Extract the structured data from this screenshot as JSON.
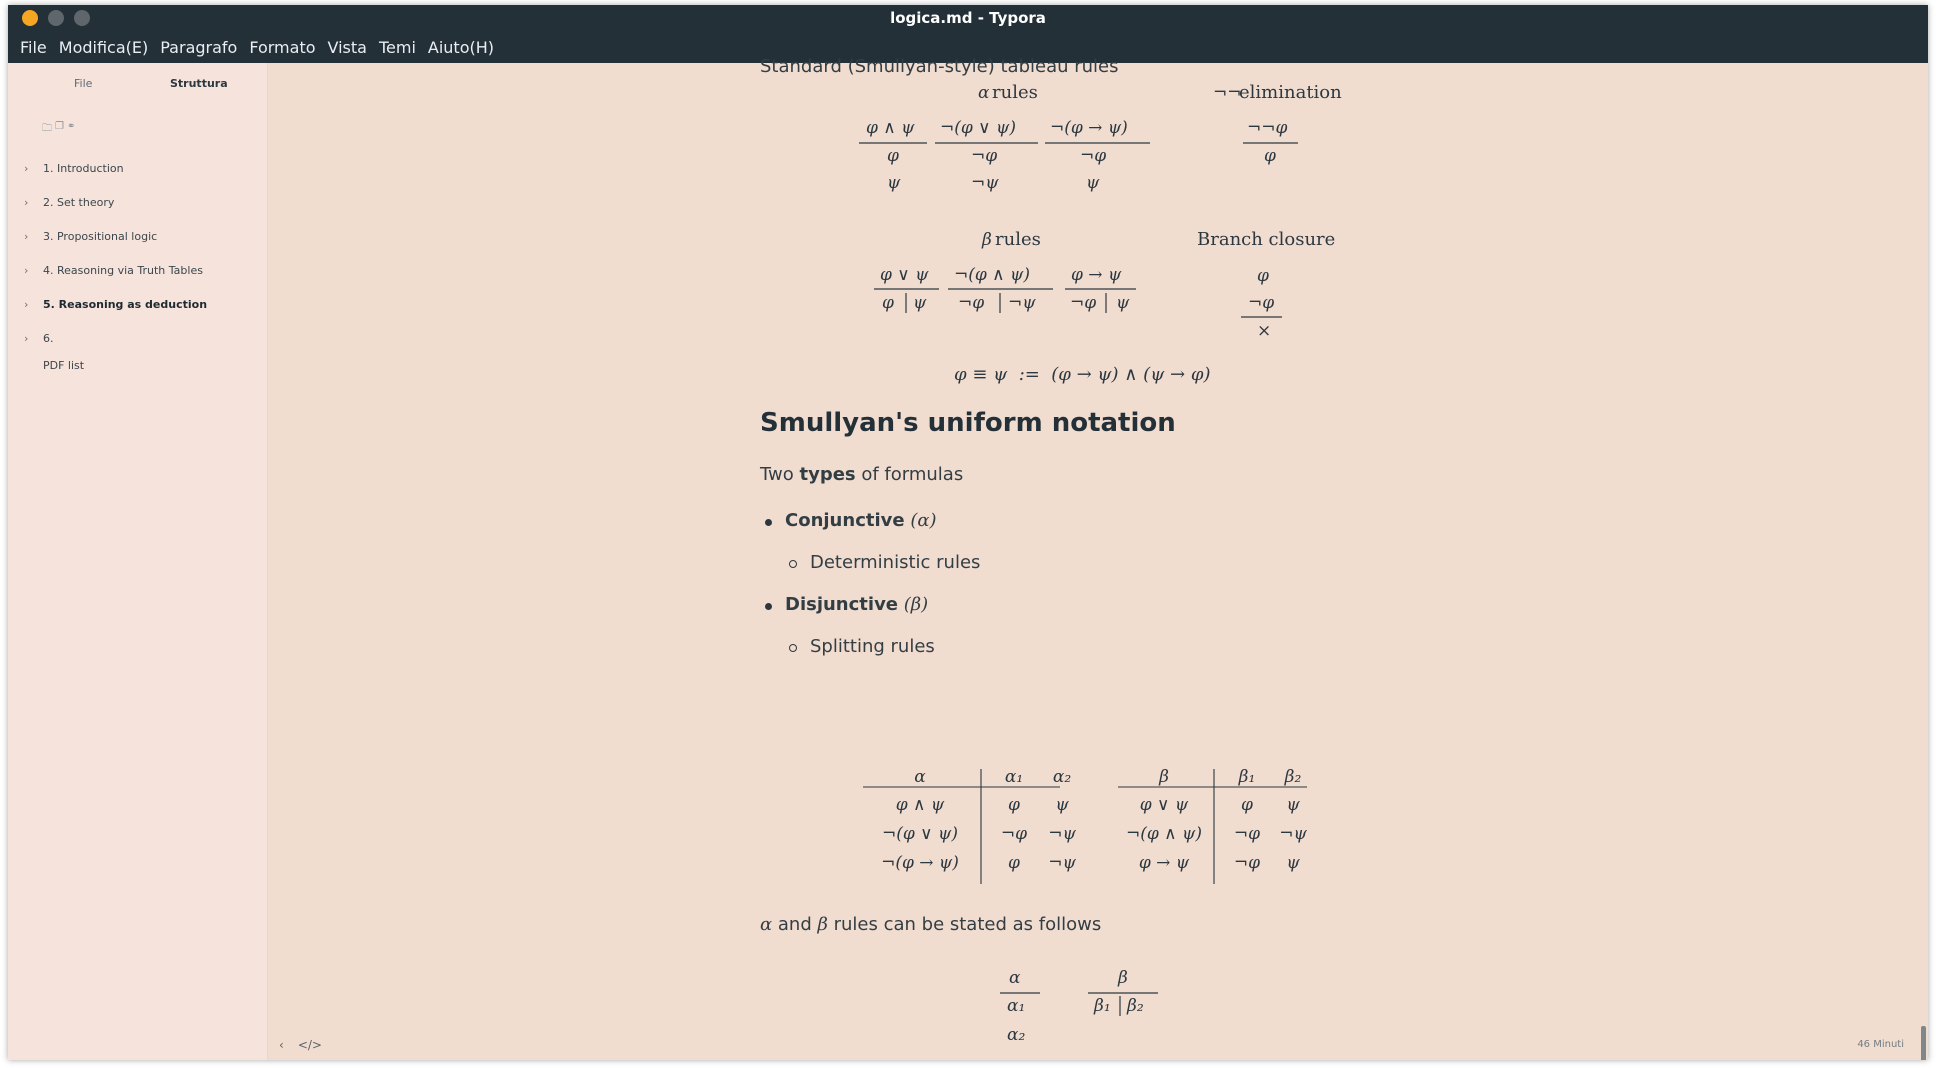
{
  "window": {
    "title": "logica.md - Typora"
  },
  "menu": [
    "File",
    "Modifica(E)",
    "Paragrafo",
    "Formato",
    "Vista",
    "Temi",
    "Aiuto(H)"
  ],
  "sidebar": {
    "tabs": {
      "file": "File",
      "outline": "Struttura"
    },
    "outline": [
      {
        "label": "1. Introduction",
        "active": false
      },
      {
        "label": "2. Set theory",
        "active": false
      },
      {
        "label": "3. Propositional logic",
        "active": false
      },
      {
        "label": "4. Reasoning via Truth Tables",
        "active": false
      },
      {
        "label": "5. Reasoning as deduction",
        "active": true
      },
      {
        "label": "6.",
        "active": false
      }
    ],
    "pdf_list": "PDF list"
  },
  "doc": {
    "top_text": "Standard (Smullyan-style) tableau rules",
    "alpha_rules_title": "rules",
    "negneg_title": "elimination",
    "beta_rules_title": "rules",
    "branch_closure_title": "Branch closure",
    "equiv_def": "φ ≡ ψ  :=  (φ → ψ) ∧ (ψ → φ)",
    "heading": "Smullyan's uniform notation",
    "para_pre": "Two ",
    "para_bold": "types",
    "para_post": " of formulas",
    "bullets": [
      {
        "bold": "Conjunctive",
        "sym": "(α)",
        "sub": "Deterministic rules"
      },
      {
        "bold": "Disjunctive",
        "sym": "(β)",
        "sub": "Splitting rules"
      }
    ],
    "alpha_beta_text": "rules can be stated as follows",
    "alpha_table": {
      "header": [
        "α",
        "α₁",
        "α₂"
      ],
      "rows": [
        [
          "φ ∧ ψ",
          "φ",
          "ψ"
        ],
        [
          "¬(φ ∨ ψ)",
          "¬φ",
          "¬ψ"
        ],
        [
          "¬(φ → ψ)",
          "φ",
          "¬ψ"
        ]
      ]
    },
    "beta_table": {
      "header": [
        "β",
        "β₁",
        "β₂"
      ],
      "rows": [
        [
          "φ ∨ ψ",
          "φ",
          "ψ"
        ],
        [
          "¬(φ ∧ ψ)",
          "¬φ",
          "¬ψ"
        ],
        [
          "φ → ψ",
          "¬φ",
          "ψ"
        ]
      ]
    }
  },
  "status": {
    "word_count": "46 Minuti"
  }
}
